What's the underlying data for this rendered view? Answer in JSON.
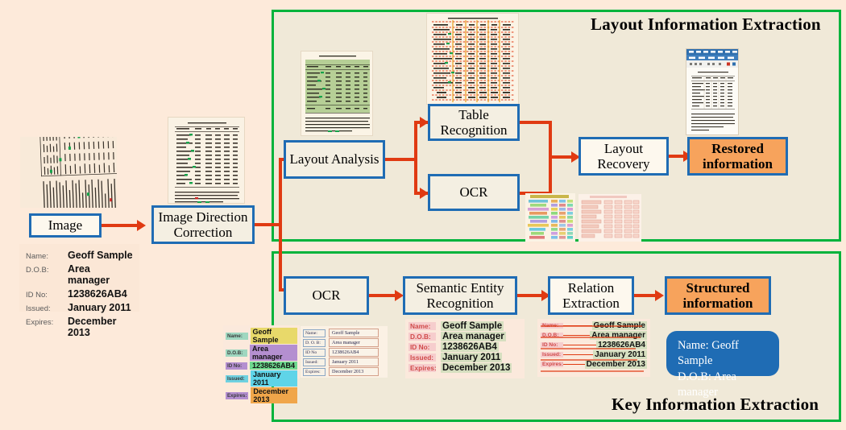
{
  "colors": {
    "page_bg": "#fdeada",
    "panel_bg": "#f0e9d8",
    "panel_border": "#00b33c",
    "box_border": "#1f6cb4",
    "box_bg": "#f4efe2",
    "result_orange": "#f7a35c",
    "arrow_red": "#e03a12",
    "result_blue": "#1f6cb4"
  },
  "panels": {
    "layout": {
      "title": "Layout Information Extraction"
    },
    "key": {
      "title": "Key Information Extraction"
    }
  },
  "boxes": {
    "image": "Image",
    "image_direction_correction": "Image Direction\nCorrection",
    "layout_analysis": "Layout Analysis",
    "table_recognition": "Table\nRecognition",
    "ocr_top": "OCR",
    "layout_recovery": "Layout\nRecovery",
    "restored_information": "Restored\ninformation",
    "ocr_bottom": "OCR",
    "semantic_entity_recognition": "Semantic Entity\nRecognition",
    "relation_extraction": "Relation\nExtraction",
    "structured_information": "Structured\ninformation"
  },
  "id_card": {
    "rows": [
      {
        "label": "Name:",
        "value": "Geoff Sample"
      },
      {
        "label": "D.O.B:",
        "value": "Area manager"
      },
      {
        "label": "ID No:",
        "value": "1238626AB4"
      },
      {
        "label": "Issued:",
        "value": "January 2011"
      },
      {
        "label": "Expires:",
        "value": "December 2013"
      }
    ]
  },
  "highlight_card": {
    "rows": [
      {
        "label": "Name:",
        "value": "Geoff Sample",
        "label_bg": "#9fd7c0",
        "value_bg": "#e8d96a"
      },
      {
        "label": "D.O.B:",
        "value": "Area manager",
        "label_bg": "#9fd7c0",
        "value_bg": "#b48fd0"
      },
      {
        "label": "ID No:",
        "value": "1238626AB4",
        "label_bg": "#b48fd0",
        "value_bg": "#6fd98f"
      },
      {
        "label": "Issued:",
        "value": "January 2011",
        "label_bg": "#6fd1e0",
        "value_bg": "#5fd4e8"
      },
      {
        "label": "Expires:",
        "value": "December 2013",
        "label_bg": "#b48fd0",
        "value_bg": "#f0a64a"
      }
    ]
  },
  "ocr_box_card": {
    "rows": [
      {
        "label": "Name:",
        "value": "Geoff  Sample"
      },
      {
        "label": "D. O. B:",
        "value": "Area  manager"
      },
      {
        "label": "ID No",
        "value": "1238626AB4"
      },
      {
        "label": "Issued:",
        "value": "January  2011"
      },
      {
        "label": "Expires:",
        "value": "December  2013"
      }
    ]
  },
  "ser_card": {
    "rows": [
      {
        "label": "Name:",
        "value": "Geoff Sample"
      },
      {
        "label": "D.O.B:",
        "value": "Area manager"
      },
      {
        "label": "ID No:",
        "value": "1238626AB4"
      },
      {
        "label": "Issued:",
        "value": "January 2011"
      },
      {
        "label": "Expires:",
        "value": "December 2013"
      }
    ]
  },
  "re_card": {
    "rows": [
      {
        "label": "Name:",
        "value": "Geoff Sample"
      },
      {
        "label": "D.O.B:",
        "value": "Area manager"
      },
      {
        "label": "ID No:",
        "value": "1238626AB4"
      },
      {
        "label": "Issued:",
        "value": "January 2011"
      },
      {
        "label": "Expires:",
        "value": "December 2013"
      }
    ]
  },
  "structured_output": {
    "line1": "Name: Geoff Sample",
    "line2": "D.O.B: Area manager",
    "line3": "…"
  },
  "thumbnails": {
    "rotated_document": "rotated-scanned-document",
    "corrected_document": "corrected-document-with-table",
    "layout_analysis_result": "table-region-highlighted-green",
    "table_recognition_result": "table-structure-red-row-orange-column-lines",
    "ocr_result_left": "ocr-text-boxes-colored",
    "ocr_result_right": "ocr-text-boxes-pink",
    "restored_document": "excel-spreadsheet-restored-table"
  }
}
